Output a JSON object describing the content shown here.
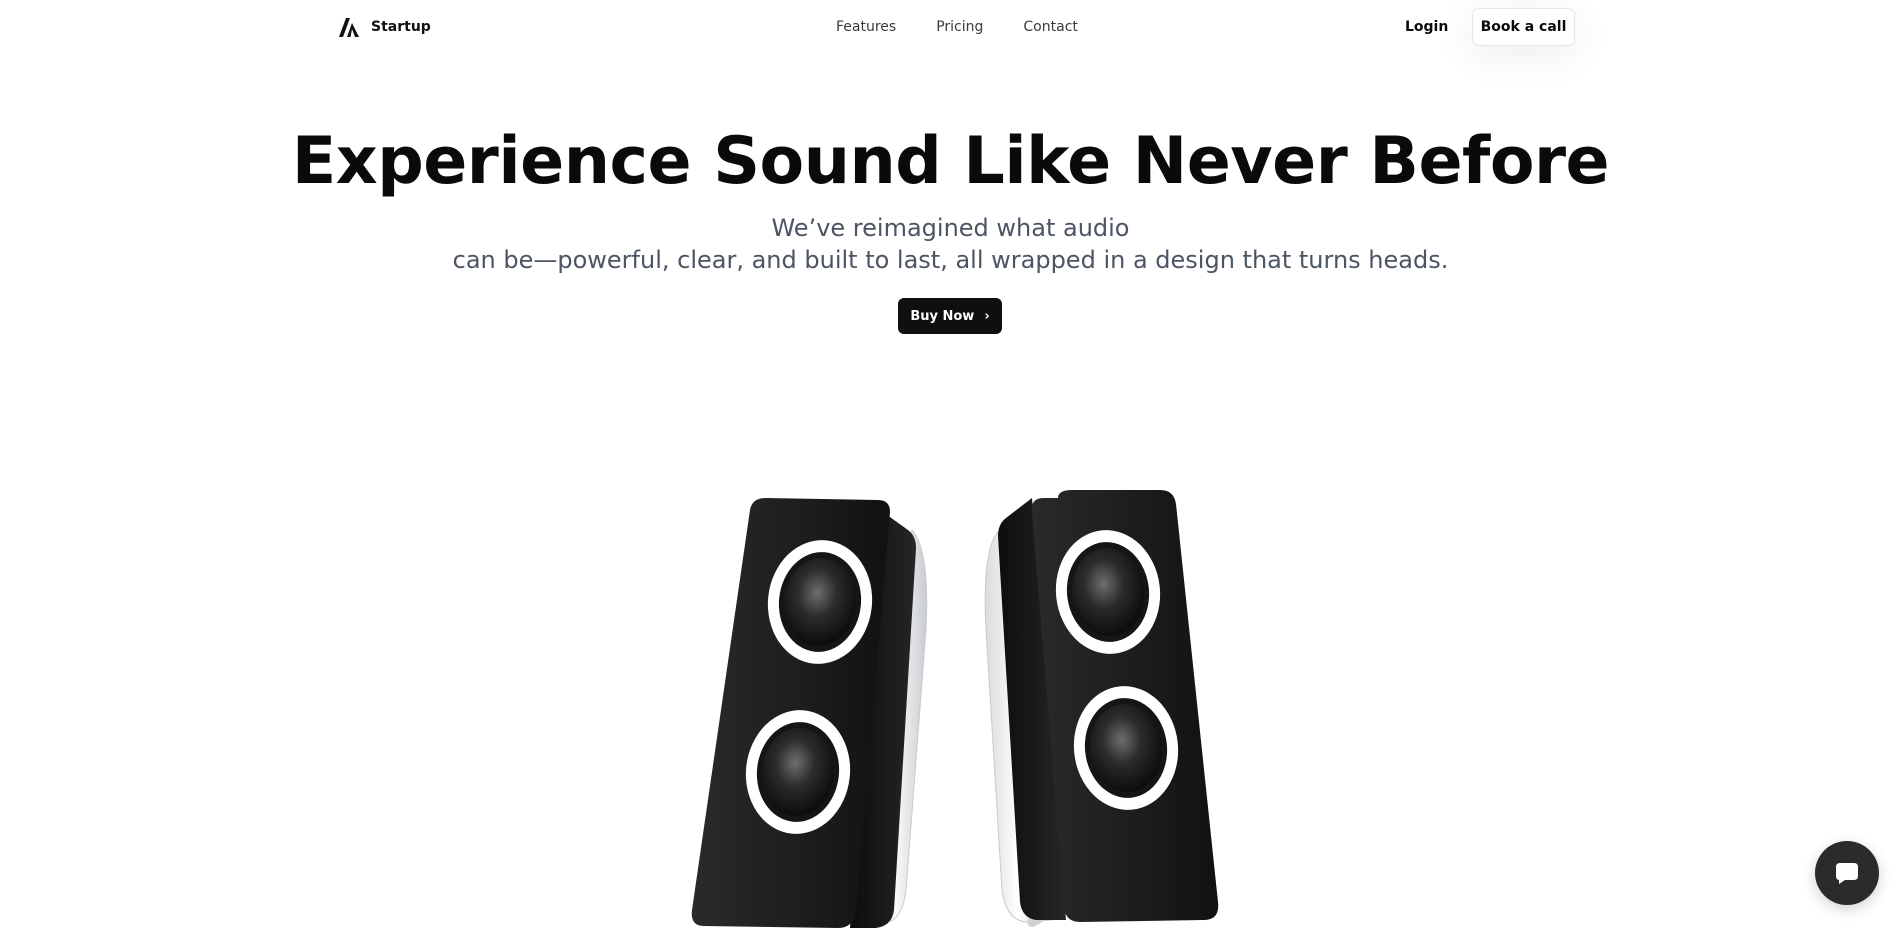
{
  "header": {
    "brand_name": "Startup",
    "nav": [
      {
        "label": "Features"
      },
      {
        "label": "Pricing"
      },
      {
        "label": "Contact"
      }
    ],
    "login_label": "Login",
    "book_call_label": "Book a call"
  },
  "hero": {
    "title": "Experience Sound Like Never Before",
    "subtitle_line1": "We’ve reimagined what audio",
    "subtitle_line2": "can be—powerful, clear, and built to last, all wrapped in a design that turns heads.",
    "cta_label": "Buy Now",
    "cta_icon": "chevron-right-icon"
  },
  "chat": {
    "icon": "chat-bubble-icon"
  },
  "colors": {
    "text": "#0a0a0a",
    "subtitle": "#4b5563",
    "cta_bg": "#0f0f0f",
    "fab_bg": "#2b2b2b"
  }
}
